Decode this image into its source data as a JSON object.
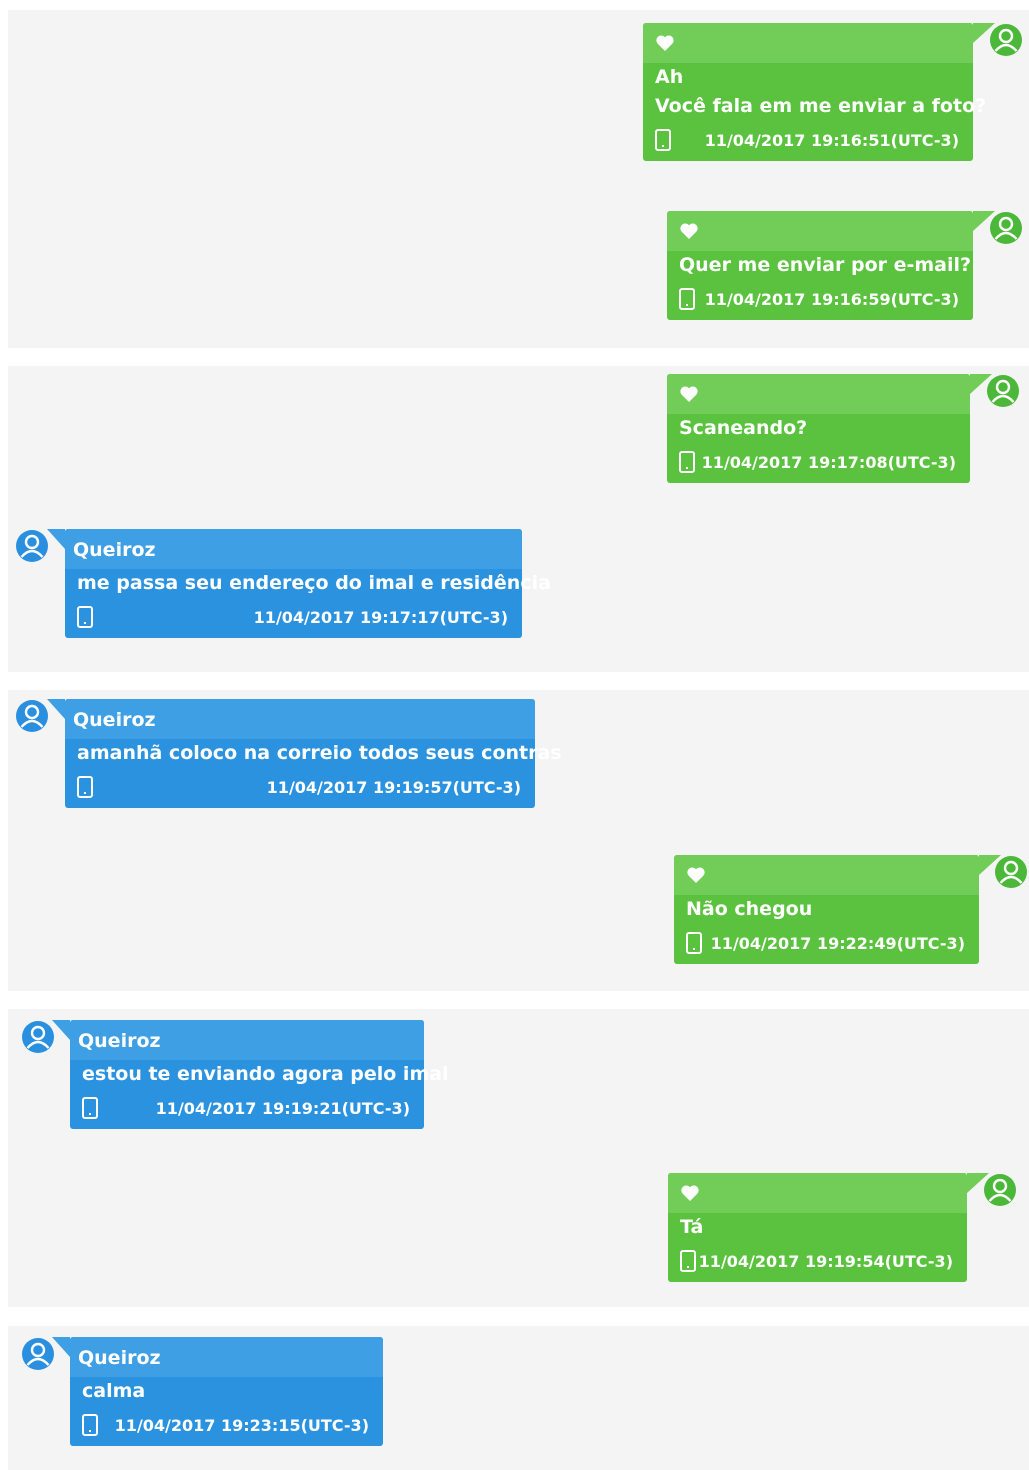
{
  "colors": {
    "outgoing_bubble": "#5ac23e",
    "outgoing_header": "#72cc58",
    "outgoing_avatar": "#4cb83a",
    "incoming_bubble": "#2b92df",
    "incoming_header": "#3e9fe4",
    "incoming_avatar": "#2b8fe0",
    "panel_background": "#f4f4f4"
  },
  "icons": {
    "avatar": "user-avatar-icon",
    "favorite": "heart-icon",
    "device": "phone-icon"
  },
  "messages": [
    {
      "direction": "outgoing",
      "lines": [
        "Ah",
        "Você fala em me enviar a foto?"
      ],
      "timestamp": "11/04/2017 19:16:51(UTC-3)"
    },
    {
      "direction": "outgoing",
      "lines": [
        "Quer me enviar por e-mail?"
      ],
      "timestamp": "11/04/2017 19:16:59(UTC-3)"
    },
    {
      "direction": "outgoing",
      "lines": [
        "Scaneando?"
      ],
      "timestamp": "11/04/2017 19:17:08(UTC-3)"
    },
    {
      "direction": "incoming",
      "sender": "Queiroz",
      "lines": [
        "me passa seu endereço  do imal e residência"
      ],
      "timestamp": "11/04/2017 19:17:17(UTC-3)"
    },
    {
      "direction": "incoming",
      "sender": "Queiroz",
      "lines": [
        "amanhã coloco na correio todos seus contras"
      ],
      "timestamp": "11/04/2017 19:19:57(UTC-3)"
    },
    {
      "direction": "outgoing",
      "lines": [
        "Não chegou"
      ],
      "timestamp": "11/04/2017 19:22:49(UTC-3)"
    },
    {
      "direction": "incoming",
      "sender": "Queiroz",
      "lines": [
        "estou te enviando agora pelo imal"
      ],
      "timestamp": "11/04/2017 19:19:21(UTC-3)"
    },
    {
      "direction": "outgoing",
      "lines": [
        "Tá"
      ],
      "timestamp": "11/04/2017 19:19:54(UTC-3)"
    },
    {
      "direction": "incoming",
      "sender": "Queiroz",
      "lines": [
        "calma"
      ],
      "timestamp": "11/04/2017 19:23:15(UTC-3)"
    }
  ]
}
